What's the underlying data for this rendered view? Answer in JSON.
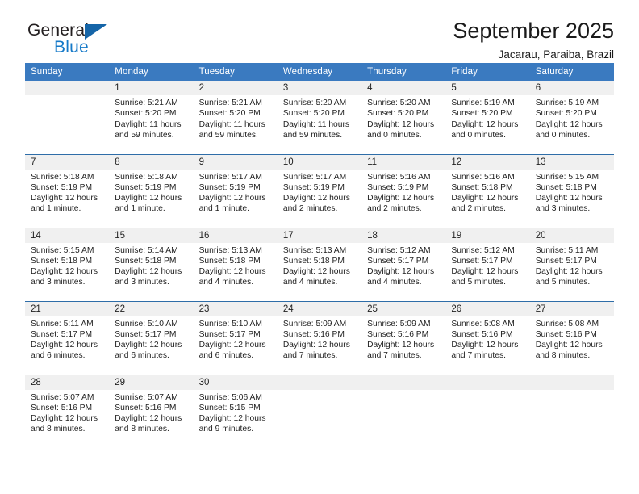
{
  "brand": {
    "name_dark": "General",
    "name_blue": "Blue",
    "triangle_color": "#1565a8",
    "blue_color": "#1579c8"
  },
  "header": {
    "title": "September 2025",
    "subtitle": "Jacarau, Paraiba, Brazil"
  },
  "calendar": {
    "header_bg": "#3a7ac0",
    "daynum_bg": "#f0f0f0",
    "row_separator": "#2e6da8",
    "weekday_labels": [
      "Sunday",
      "Monday",
      "Tuesday",
      "Wednesday",
      "Thursday",
      "Friday",
      "Saturday"
    ],
    "weeks": [
      [
        {
          "day": "",
          "sunrise": "",
          "sunset": "",
          "daylight_1": "",
          "daylight_2": ""
        },
        {
          "day": "1",
          "sunrise": "Sunrise: 5:21 AM",
          "sunset": "Sunset: 5:20 PM",
          "daylight_1": "Daylight: 11 hours",
          "daylight_2": "and 59 minutes."
        },
        {
          "day": "2",
          "sunrise": "Sunrise: 5:21 AM",
          "sunset": "Sunset: 5:20 PM",
          "daylight_1": "Daylight: 11 hours",
          "daylight_2": "and 59 minutes."
        },
        {
          "day": "3",
          "sunrise": "Sunrise: 5:20 AM",
          "sunset": "Sunset: 5:20 PM",
          "daylight_1": "Daylight: 11 hours",
          "daylight_2": "and 59 minutes."
        },
        {
          "day": "4",
          "sunrise": "Sunrise: 5:20 AM",
          "sunset": "Sunset: 5:20 PM",
          "daylight_1": "Daylight: 12 hours",
          "daylight_2": "and 0 minutes."
        },
        {
          "day": "5",
          "sunrise": "Sunrise: 5:19 AM",
          "sunset": "Sunset: 5:20 PM",
          "daylight_1": "Daylight: 12 hours",
          "daylight_2": "and 0 minutes."
        },
        {
          "day": "6",
          "sunrise": "Sunrise: 5:19 AM",
          "sunset": "Sunset: 5:20 PM",
          "daylight_1": "Daylight: 12 hours",
          "daylight_2": "and 0 minutes."
        }
      ],
      [
        {
          "day": "7",
          "sunrise": "Sunrise: 5:18 AM",
          "sunset": "Sunset: 5:19 PM",
          "daylight_1": "Daylight: 12 hours",
          "daylight_2": "and 1 minute."
        },
        {
          "day": "8",
          "sunrise": "Sunrise: 5:18 AM",
          "sunset": "Sunset: 5:19 PM",
          "daylight_1": "Daylight: 12 hours",
          "daylight_2": "and 1 minute."
        },
        {
          "day": "9",
          "sunrise": "Sunrise: 5:17 AM",
          "sunset": "Sunset: 5:19 PM",
          "daylight_1": "Daylight: 12 hours",
          "daylight_2": "and 1 minute."
        },
        {
          "day": "10",
          "sunrise": "Sunrise: 5:17 AM",
          "sunset": "Sunset: 5:19 PM",
          "daylight_1": "Daylight: 12 hours",
          "daylight_2": "and 2 minutes."
        },
        {
          "day": "11",
          "sunrise": "Sunrise: 5:16 AM",
          "sunset": "Sunset: 5:19 PM",
          "daylight_1": "Daylight: 12 hours",
          "daylight_2": "and 2 minutes."
        },
        {
          "day": "12",
          "sunrise": "Sunrise: 5:16 AM",
          "sunset": "Sunset: 5:18 PM",
          "daylight_1": "Daylight: 12 hours",
          "daylight_2": "and 2 minutes."
        },
        {
          "day": "13",
          "sunrise": "Sunrise: 5:15 AM",
          "sunset": "Sunset: 5:18 PM",
          "daylight_1": "Daylight: 12 hours",
          "daylight_2": "and 3 minutes."
        }
      ],
      [
        {
          "day": "14",
          "sunrise": "Sunrise: 5:15 AM",
          "sunset": "Sunset: 5:18 PM",
          "daylight_1": "Daylight: 12 hours",
          "daylight_2": "and 3 minutes."
        },
        {
          "day": "15",
          "sunrise": "Sunrise: 5:14 AM",
          "sunset": "Sunset: 5:18 PM",
          "daylight_1": "Daylight: 12 hours",
          "daylight_2": "and 3 minutes."
        },
        {
          "day": "16",
          "sunrise": "Sunrise: 5:13 AM",
          "sunset": "Sunset: 5:18 PM",
          "daylight_1": "Daylight: 12 hours",
          "daylight_2": "and 4 minutes."
        },
        {
          "day": "17",
          "sunrise": "Sunrise: 5:13 AM",
          "sunset": "Sunset: 5:18 PM",
          "daylight_1": "Daylight: 12 hours",
          "daylight_2": "and 4 minutes."
        },
        {
          "day": "18",
          "sunrise": "Sunrise: 5:12 AM",
          "sunset": "Sunset: 5:17 PM",
          "daylight_1": "Daylight: 12 hours",
          "daylight_2": "and 4 minutes."
        },
        {
          "day": "19",
          "sunrise": "Sunrise: 5:12 AM",
          "sunset": "Sunset: 5:17 PM",
          "daylight_1": "Daylight: 12 hours",
          "daylight_2": "and 5 minutes."
        },
        {
          "day": "20",
          "sunrise": "Sunrise: 5:11 AM",
          "sunset": "Sunset: 5:17 PM",
          "daylight_1": "Daylight: 12 hours",
          "daylight_2": "and 5 minutes."
        }
      ],
      [
        {
          "day": "21",
          "sunrise": "Sunrise: 5:11 AM",
          "sunset": "Sunset: 5:17 PM",
          "daylight_1": "Daylight: 12 hours",
          "daylight_2": "and 6 minutes."
        },
        {
          "day": "22",
          "sunrise": "Sunrise: 5:10 AM",
          "sunset": "Sunset: 5:17 PM",
          "daylight_1": "Daylight: 12 hours",
          "daylight_2": "and 6 minutes."
        },
        {
          "day": "23",
          "sunrise": "Sunrise: 5:10 AM",
          "sunset": "Sunset: 5:17 PM",
          "daylight_1": "Daylight: 12 hours",
          "daylight_2": "and 6 minutes."
        },
        {
          "day": "24",
          "sunrise": "Sunrise: 5:09 AM",
          "sunset": "Sunset: 5:16 PM",
          "daylight_1": "Daylight: 12 hours",
          "daylight_2": "and 7 minutes."
        },
        {
          "day": "25",
          "sunrise": "Sunrise: 5:09 AM",
          "sunset": "Sunset: 5:16 PM",
          "daylight_1": "Daylight: 12 hours",
          "daylight_2": "and 7 minutes."
        },
        {
          "day": "26",
          "sunrise": "Sunrise: 5:08 AM",
          "sunset": "Sunset: 5:16 PM",
          "daylight_1": "Daylight: 12 hours",
          "daylight_2": "and 7 minutes."
        },
        {
          "day": "27",
          "sunrise": "Sunrise: 5:08 AM",
          "sunset": "Sunset: 5:16 PM",
          "daylight_1": "Daylight: 12 hours",
          "daylight_2": "and 8 minutes."
        }
      ],
      [
        {
          "day": "28",
          "sunrise": "Sunrise: 5:07 AM",
          "sunset": "Sunset: 5:16 PM",
          "daylight_1": "Daylight: 12 hours",
          "daylight_2": "and 8 minutes."
        },
        {
          "day": "29",
          "sunrise": "Sunrise: 5:07 AM",
          "sunset": "Sunset: 5:16 PM",
          "daylight_1": "Daylight: 12 hours",
          "daylight_2": "and 8 minutes."
        },
        {
          "day": "30",
          "sunrise": "Sunrise: 5:06 AM",
          "sunset": "Sunset: 5:15 PM",
          "daylight_1": "Daylight: 12 hours",
          "daylight_2": "and 9 minutes."
        },
        {
          "day": "",
          "sunrise": "",
          "sunset": "",
          "daylight_1": "",
          "daylight_2": ""
        },
        {
          "day": "",
          "sunrise": "",
          "sunset": "",
          "daylight_1": "",
          "daylight_2": ""
        },
        {
          "day": "",
          "sunrise": "",
          "sunset": "",
          "daylight_1": "",
          "daylight_2": ""
        },
        {
          "day": "",
          "sunrise": "",
          "sunset": "",
          "daylight_1": "",
          "daylight_2": ""
        }
      ]
    ]
  }
}
